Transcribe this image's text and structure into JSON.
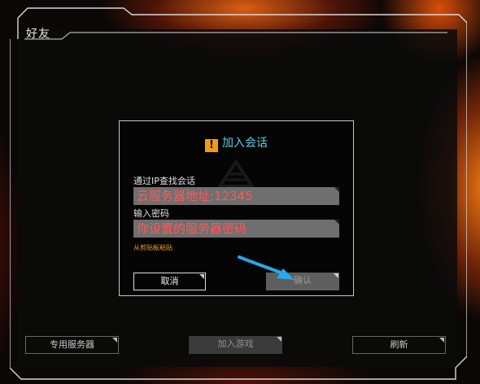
{
  "panel": {
    "title": "好友"
  },
  "dialog": {
    "title": "加入会话",
    "icon": "warning-icon",
    "ip_label": "通过IP查找会话",
    "ip_value": "云服务器地址:12345",
    "password_label": "输入密码",
    "password_value": "你设置的服务器密码",
    "paste_link": "从剪贴板粘贴",
    "cancel_label": "取消",
    "confirm_label": "确认"
  },
  "bottom_bar": {
    "dedicated_server_label": "专用服务器",
    "join_game_label": "加入游戏",
    "refresh_label": "刷新"
  },
  "colors": {
    "accent_title": "#5fc9e8",
    "warning": "#f39a14",
    "input_text": "#ff5858",
    "annotation_arrow": "#2aa7e6"
  }
}
